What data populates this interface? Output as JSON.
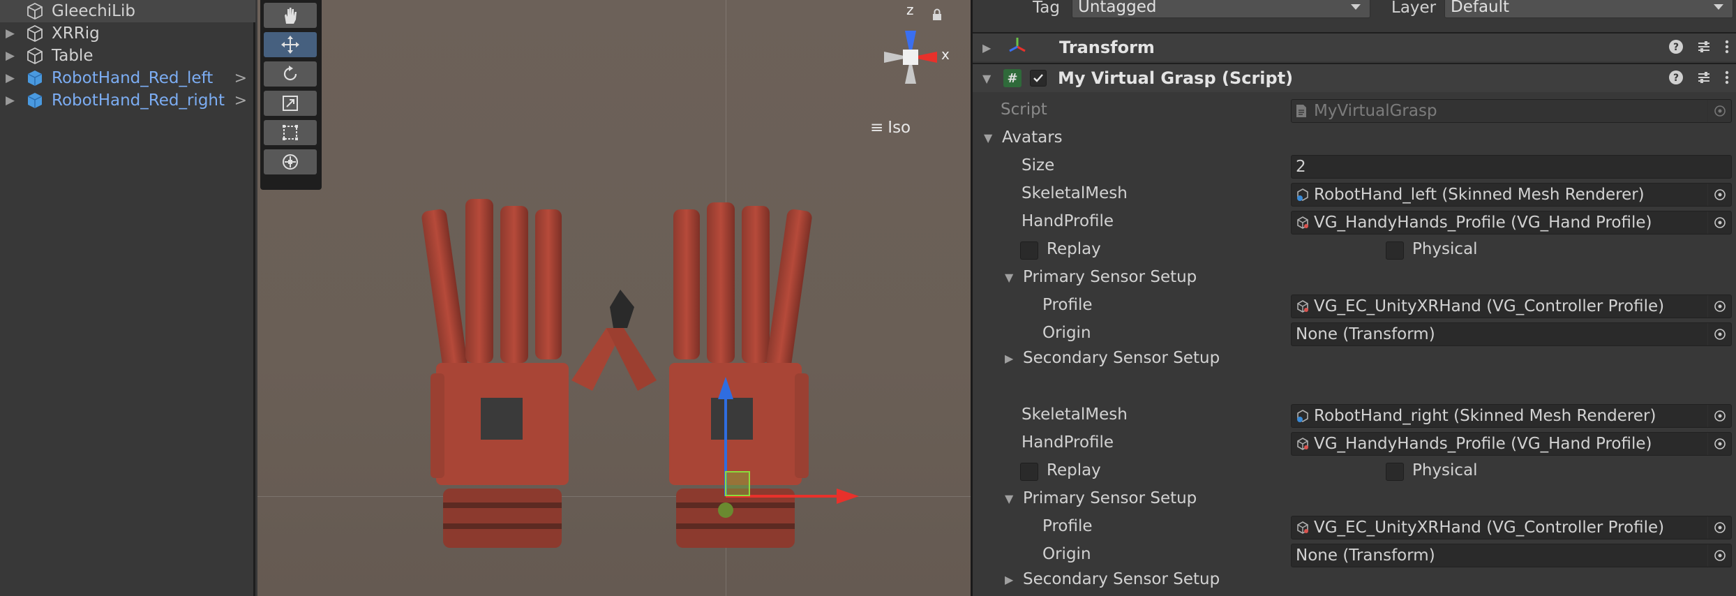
{
  "hierarchy": {
    "items": [
      {
        "label": "GleechiLib",
        "icon": "gameobject-icon",
        "prefab": false,
        "expanded": false,
        "selected": true
      },
      {
        "label": "XRRig",
        "icon": "gameobject-icon",
        "prefab": false,
        "expanded": false,
        "selected": false
      },
      {
        "label": "Table",
        "icon": "gameobject-icon",
        "prefab": false,
        "expanded": false,
        "selected": false
      },
      {
        "label": "RobotHand_Red_left",
        "icon": "prefab-icon",
        "prefab": true,
        "expanded": false,
        "selected": false
      },
      {
        "label": "RobotHand_Red_right",
        "icon": "prefab-icon",
        "prefab": true,
        "expanded": false,
        "selected": false
      }
    ]
  },
  "scene": {
    "tools": [
      "hand-tool-icon",
      "move-tool-icon",
      "rotate-tool-icon",
      "scale-tool-icon",
      "rect-tool-icon",
      "transform-tool-icon"
    ],
    "active_tool": "move-tool-icon",
    "gizmo": {
      "z_label": "z",
      "x_label": "x",
      "projection_label": "Iso"
    }
  },
  "inspector": {
    "tag_label": "Tag",
    "tag_value": "Untagged",
    "layer_label": "Layer",
    "layer_value": "Default",
    "transform_title": "Transform",
    "component_title": "My Virtual Grasp (Script)",
    "script_label": "Script",
    "script_value": "MyVirtualGrasp",
    "avatars_label": "Avatars",
    "size_label": "Size",
    "size_value": "2",
    "avatars": [
      {
        "skeletal_label": "SkeletalMesh",
        "skeletal_value": "RobotHand_left (Skinned Mesh Renderer)",
        "profile_label": "HandProfile",
        "profile_value": "VG_HandyHands_Profile (VG_Hand Profile)",
        "replay_label": "Replay",
        "physical_label": "Physical",
        "primary_label": "Primary Sensor Setup",
        "sensor_profile_label": "Profile",
        "sensor_profile_value": "VG_EC_UnityXRHand (VG_Controller Profile)",
        "origin_label": "Origin",
        "origin_value": "None (Transform)",
        "secondary_label": "Secondary Sensor Setup"
      },
      {
        "skeletal_label": "SkeletalMesh",
        "skeletal_value": "RobotHand_right (Skinned Mesh Renderer)",
        "profile_label": "HandProfile",
        "profile_value": "VG_HandyHands_Profile (VG_Hand Profile)",
        "replay_label": "Replay",
        "physical_label": "Physical",
        "primary_label": "Primary Sensor Setup",
        "sensor_profile_label": "Profile",
        "sensor_profile_value": "VG_EC_UnityXRHand (VG_Controller Profile)",
        "origin_label": "Origin",
        "origin_value": "None (Transform)",
        "secondary_label": "Secondary Sensor Setup"
      }
    ]
  },
  "colors": {
    "prefab_text": "#7cadf3",
    "active_tool": "#46607f",
    "axis_x": "#e8312b",
    "axis_y": "#2f6de0",
    "axis_z": "#3a6ff0"
  }
}
